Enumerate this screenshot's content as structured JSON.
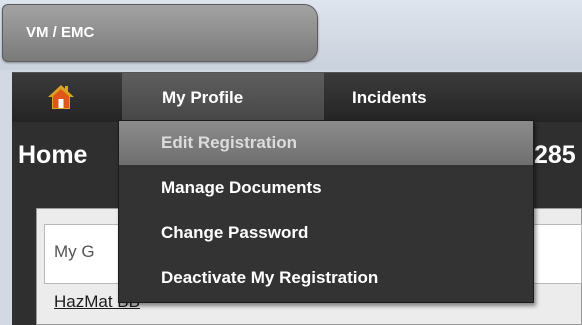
{
  "app": {
    "title": "VM / EMC"
  },
  "nav": {
    "home_icon": "home-icon",
    "tabs": [
      {
        "label": "My Profile",
        "active": true
      },
      {
        "label": "Incidents",
        "active": false
      }
    ]
  },
  "page": {
    "heading": "Home",
    "heading_right": "285",
    "panel": {
      "label": "My G",
      "link": "HazMat BB"
    }
  },
  "profile_menu": {
    "items": [
      {
        "label": "Edit Registration",
        "highlighted": true
      },
      {
        "label": "Manage Documents",
        "highlighted": false
      },
      {
        "label": "Change Password",
        "highlighted": false
      },
      {
        "label": "Deactivate My Registration",
        "highlighted": false
      }
    ]
  },
  "colors": {
    "nav_bar": "#2b2b2b",
    "menu_bg": "#333333",
    "menu_highlight": "#7d7d7d",
    "home_house": "#e0561a",
    "home_roof": "#d9a422"
  }
}
